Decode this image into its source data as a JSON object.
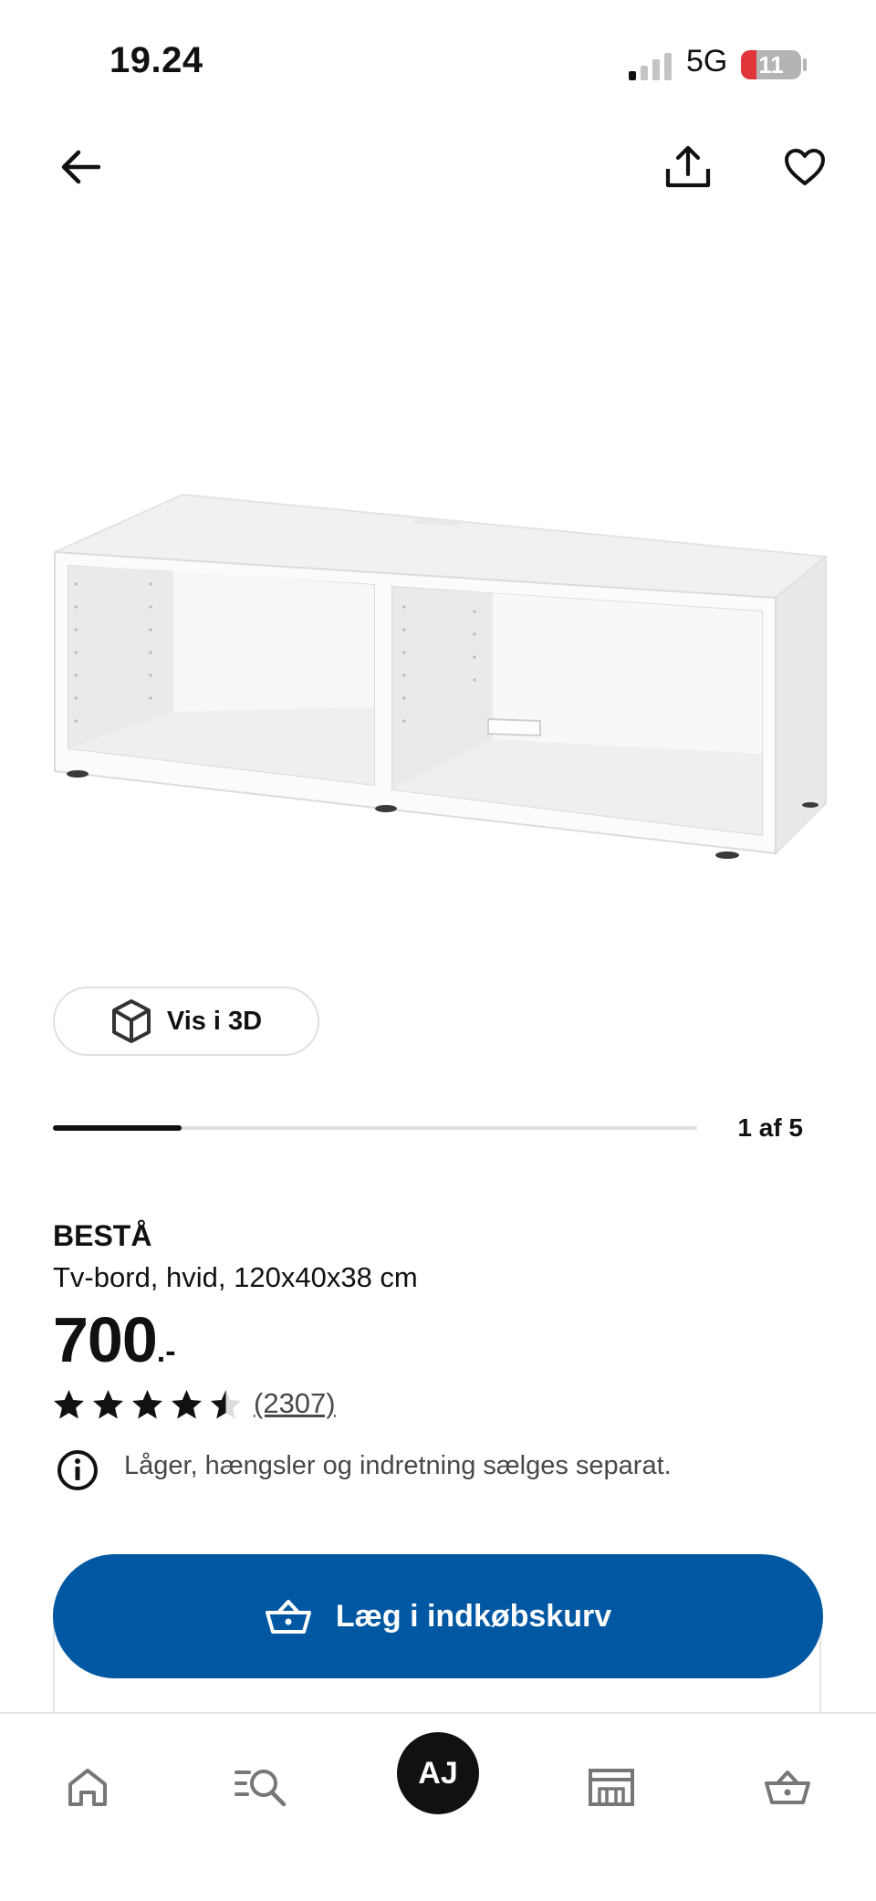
{
  "status_bar": {
    "time": "19.24",
    "network": "5G",
    "battery_level": "11",
    "battery_color": "#e0353b"
  },
  "nav": {
    "back_icon": "arrow-left-icon",
    "share_icon": "share-icon",
    "favorite_icon": "heart-icon"
  },
  "gallery": {
    "view_3d_label": "Vis i 3D",
    "view_3d_icon": "cube-icon",
    "counter": "1 af 5",
    "progress_fraction": 0.2
  },
  "product": {
    "name": "BESTÅ",
    "description": "Tv-bord, hvid, 120x40x38 cm",
    "price": "700",
    "price_suffix": ".-",
    "rating": 4.5,
    "rating_count": "(2307)",
    "notice": "Låger, hængsler og indretning sælges separat.",
    "notice_icon": "info-icon"
  },
  "cart": {
    "button_label": "Læg i indkøbskurv",
    "button_icon": "basket-icon",
    "accent_color": "#0058a3"
  },
  "tabbar": {
    "home_icon": "home-icon",
    "search_icon": "search-list-icon",
    "profile_initials": "AJ",
    "stores_icon": "store-icon",
    "cart_icon": "basket-icon"
  }
}
